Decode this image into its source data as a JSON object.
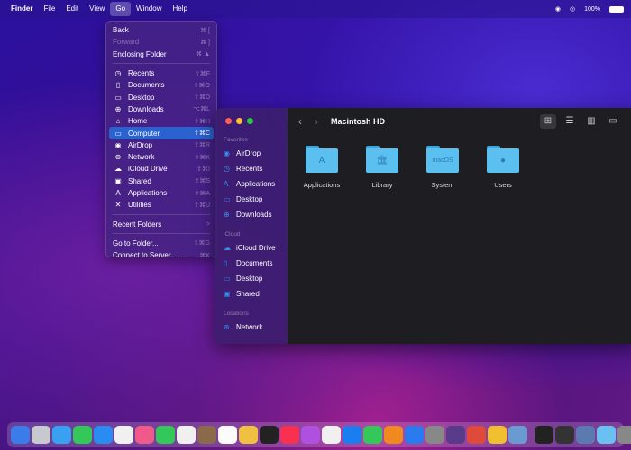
{
  "menubar": {
    "items": [
      "Finder",
      "File",
      "Edit",
      "View",
      "Go",
      "Window",
      "Help"
    ],
    "active": "Go",
    "battery": "100%"
  },
  "go_menu": {
    "top": [
      {
        "label": "Back",
        "shortcut": "⌘ ["
      },
      {
        "label": "Forward",
        "shortcut": "⌘ ]",
        "disabled": true
      },
      {
        "label": "Enclosing Folder",
        "shortcut": "⌘ ▲"
      }
    ],
    "places": [
      {
        "icon": "◷",
        "label": "Recents",
        "shortcut": "⇧⌘F"
      },
      {
        "icon": "▯",
        "label": "Documents",
        "shortcut": "⇧⌘O"
      },
      {
        "icon": "▭",
        "label": "Desktop",
        "shortcut": "⇧⌘D"
      },
      {
        "icon": "⊕",
        "label": "Downloads",
        "shortcut": "⌥⌘L"
      },
      {
        "icon": "⌂",
        "label": "Home",
        "shortcut": "⇧⌘H"
      },
      {
        "icon": "▭",
        "label": "Computer",
        "shortcut": "⇧⌘C",
        "selected": true
      },
      {
        "icon": "◉",
        "label": "AirDrop",
        "shortcut": "⇧⌘R"
      },
      {
        "icon": "⊛",
        "label": "Network",
        "shortcut": "⇧⌘K"
      },
      {
        "icon": "☁",
        "label": "iCloud Drive",
        "shortcut": "⇧⌘I"
      },
      {
        "icon": "▣",
        "label": "Shared",
        "shortcut": "⇧⌘S"
      },
      {
        "icon": "A",
        "label": "Applications",
        "shortcut": "⇧⌘A"
      },
      {
        "icon": "✕",
        "label": "Utilities",
        "shortcut": "⇧⌘U"
      }
    ],
    "recent": {
      "label": "Recent Folders",
      "shortcut": ">"
    },
    "bottom": [
      {
        "label": "Go to Folder...",
        "shortcut": "⇧⌘G"
      },
      {
        "label": "Connect to Server...",
        "shortcut": "⌘K"
      }
    ]
  },
  "finder": {
    "title": "Macintosh HD",
    "sections": [
      {
        "header": "Favorites",
        "items": [
          {
            "icon": "◉",
            "label": "AirDrop"
          },
          {
            "icon": "◷",
            "label": "Recents"
          },
          {
            "icon": "A",
            "label": "Applications"
          },
          {
            "icon": "▭",
            "label": "Desktop"
          },
          {
            "icon": "⊕",
            "label": "Downloads"
          }
        ]
      },
      {
        "header": "iCloud",
        "items": [
          {
            "icon": "☁",
            "label": "iCloud Drive"
          },
          {
            "icon": "▯",
            "label": "Documents"
          },
          {
            "icon": "▭",
            "label": "Desktop"
          },
          {
            "icon": "▣",
            "label": "Shared"
          }
        ]
      },
      {
        "header": "Locations",
        "items": [
          {
            "icon": "⊛",
            "label": "Network"
          }
        ]
      }
    ],
    "folders": [
      {
        "label": "Applications",
        "glyph": "A"
      },
      {
        "label": "Library",
        "glyph": "🏛"
      },
      {
        "label": "System",
        "glyph": "macOS"
      },
      {
        "label": "Users",
        "glyph": "●"
      }
    ]
  },
  "dock": {
    "colors": [
      "#3a7ce8",
      "#c8c8d0",
      "#3aa0f0",
      "#34c759",
      "#2a8cf0",
      "#f0f0f0",
      "#f05a8a",
      "#34c759",
      "#f0f0f0",
      "#8a6a4a",
      "#fbfbfb",
      "#f0c040",
      "#222",
      "#fa3050",
      "#b050e0",
      "#f0f0f0",
      "#1a7ef0",
      "#34c759",
      "#f08a20",
      "#2a7af0",
      "#888",
      "#5a3a8a",
      "#e04a3a",
      "#f0c030",
      "#6a9ad0",
      "#222",
      "#333",
      "#5a7ab0",
      "#6ac0f0",
      "#888"
    ]
  }
}
